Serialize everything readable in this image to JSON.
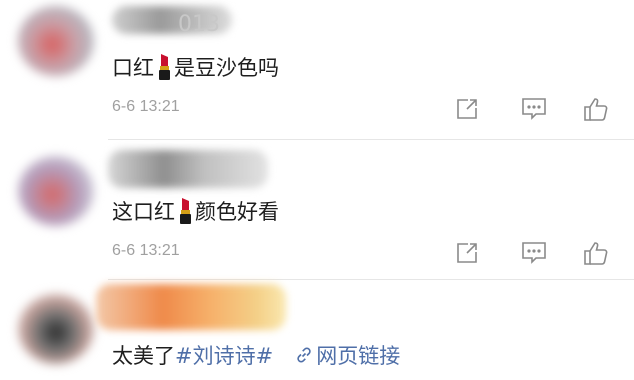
{
  "comments": [
    {
      "name_fragment": "013",
      "text_before": "口红",
      "text_after": "是豆沙色吗",
      "time": "6-6 13:21"
    },
    {
      "text_before": "这口红",
      "text_after": "颜色好看",
      "time": "6-6 13:21"
    },
    {
      "text_plain": "太美了",
      "hashtag": "#刘诗诗#",
      "link_label": "网页链接"
    }
  ],
  "icons": {
    "lipstick": "lipstick-emoji",
    "share": "share-icon",
    "comment": "comment-icon",
    "like": "thumbs-up-icon",
    "link": "link-icon"
  },
  "colors": {
    "link": "#4f6fa8",
    "time": "#a0a0a0",
    "lipstick_red": "#c8102e"
  }
}
